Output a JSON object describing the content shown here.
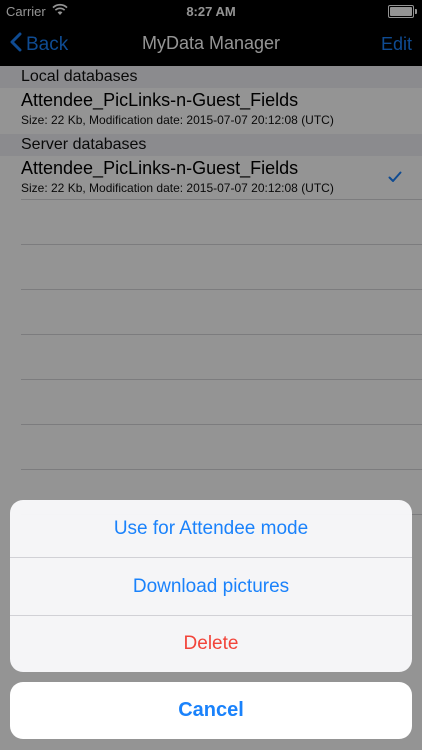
{
  "status_bar": {
    "carrier": "Carrier",
    "time": "8:27 AM"
  },
  "nav": {
    "back_label": "Back",
    "title": "MyData Manager",
    "edit_label": "Edit"
  },
  "sections": [
    {
      "header": "Local databases",
      "rows": [
        {
          "title": "Attendee_PicLinks-n-Guest_Fields",
          "subtitle": "Size: 22 Kb, Modification date: 2015-07-07 20:12:08 (UTC)"
        }
      ]
    },
    {
      "header": "Server databases",
      "rows": [
        {
          "title": "Attendee_PicLinks-n-Guest_Fields",
          "subtitle": "Size: 22 Kb, Modification date: 2015-07-07 20:12:08 (UTC)",
          "checked": true
        }
      ]
    }
  ],
  "action_sheet": {
    "actions": [
      {
        "label": "Use for Attendee mode",
        "style": "default"
      },
      {
        "label": "Download pictures",
        "style": "default"
      },
      {
        "label": "Delete",
        "style": "destructive"
      }
    ],
    "cancel_label": "Cancel"
  },
  "colors": {
    "tint": "#1a82fb",
    "destructive": "#f2443a"
  },
  "icons": {
    "back": "chevron-left-icon",
    "check": "checkmark-icon",
    "wifi": "wifi-icon",
    "battery": "battery-icon"
  }
}
